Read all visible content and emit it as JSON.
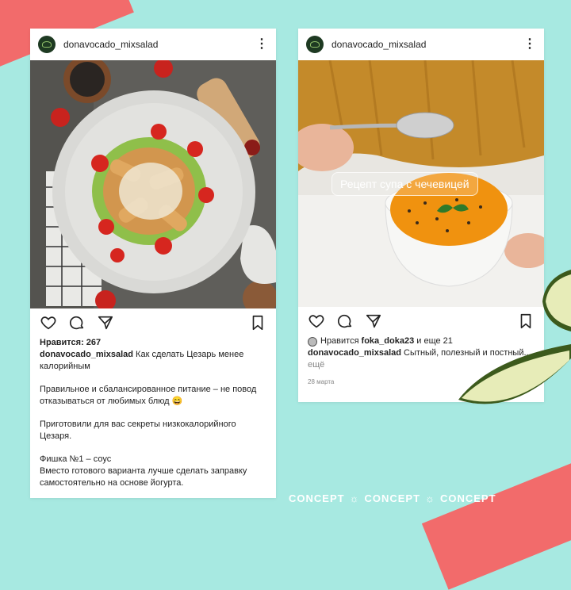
{
  "brand": {
    "accent": "#f26b6b",
    "background": "#a7e9e1"
  },
  "post1": {
    "username": "donavocado_mixsalad",
    "likes": "Нравится: 267",
    "caption_user": "donavocado_mixsalad",
    "caption_text": " Как сделать Цезарь менее калорийным",
    "paragraphs": [
      "Правильное и сбалансированное питание – не повод отказываться от любимых блюд 😄",
      "Приготовили для вас секреты низкокалорийного Цезаря.",
      "Фишка №1 – соус\nВместо готового варианта лучше сделать заправку самостоятельно на основе йогурта."
    ],
    "icons": [
      "heart-icon",
      "comment-icon",
      "share-icon",
      "bookmark-icon"
    ]
  },
  "post2": {
    "username": "donavocado_mixsalad",
    "overlay_text": "Рецепт супа с чечевицей",
    "likes_prefix": "Нравится ",
    "likes_user": "foka_doka23",
    "likes_suffix": " и еще 21",
    "caption_user": "donavocado_mixsalad",
    "caption_text": " Сытный, полезный и постный...",
    "more": "ещё",
    "date": "28 марта"
  },
  "footer": {
    "concept": [
      "CONCEPT",
      "CONCEPT",
      "CONCEPT"
    ],
    "separator": "☼"
  }
}
